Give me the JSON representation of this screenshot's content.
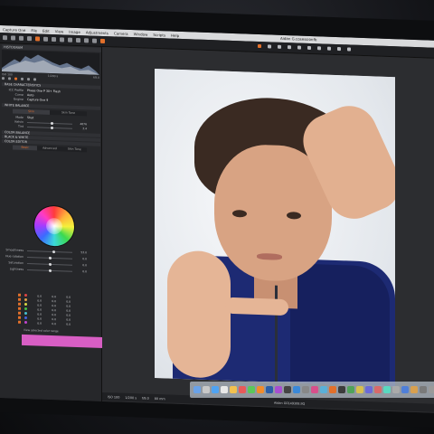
{
  "menubar": {
    "items": [
      "Capture One",
      "File",
      "Edit",
      "View",
      "Image",
      "Adjustments",
      "Camera",
      "Window",
      "Scripts",
      "Help"
    ],
    "window_title": "Aidan G.cosessionfb"
  },
  "panel": {
    "histogram_label": "HISTOGRAM",
    "readouts": {
      "iso": "ISO 100",
      "shutter": "1/200 s",
      "aperture": "f/8.0"
    },
    "base_characteristics": {
      "title": "BASE CHARACTERISTICS",
      "rows": [
        {
          "label": "ICC Profile",
          "value": "Phase One P 30+ Flash"
        },
        {
          "label": "Curve",
          "value": "Auto"
        },
        {
          "label": "Engine",
          "value": "Capture One 9"
        }
      ]
    },
    "white_balance": {
      "title": "WHITE BALANCE",
      "tabs": [
        "Skin",
        "Skin Tone"
      ],
      "rows": [
        {
          "label": "Mode",
          "value": "Shot",
          "num": ""
        },
        {
          "label": "Kelvin",
          "value": "",
          "num": "4876"
        },
        {
          "label": "Tint",
          "value": "",
          "num": "3.4"
        }
      ]
    },
    "sections": [
      "COLOR BALANCE",
      "BLACK & WHITE",
      "COLOR EDITOR"
    ],
    "color_editor_tabs": [
      "Basic",
      "Advanced",
      "Skin Tone"
    ],
    "sliders": [
      {
        "label": "Smoothness",
        "num": "53.0"
      },
      {
        "label": "Hue rotation",
        "num": "0.0"
      },
      {
        "label": "Saturation",
        "num": "0.0"
      },
      {
        "label": "Lightness",
        "num": "0.0"
      }
    ],
    "color_table": [
      {
        "c1": "0.0",
        "c2": "0.0",
        "c3": "0.0"
      },
      {
        "c1": "0.0",
        "c2": "0.0",
        "c3": "0.0"
      },
      {
        "c1": "0.0",
        "c2": "0.0",
        "c3": "0.0"
      },
      {
        "c1": "0.0",
        "c2": "0.0",
        "c3": "0.0"
      },
      {
        "c1": "0.0",
        "c2": "0.0",
        "c3": "0.0"
      },
      {
        "c1": "0.0",
        "c2": "0.0",
        "c3": "0.0"
      },
      {
        "c1": "0.0",
        "c2": "0.0",
        "c3": "0.0"
      }
    ],
    "swatch_label": "View selected color range",
    "swatch_color": "#d85ec4"
  },
  "viewer": {
    "status": {
      "iso": "ISO 100",
      "shutter": "1/200 s",
      "aperture": "f/8.0",
      "focal": "80 mm"
    },
    "filename": "Aidan G0149308.IIQ"
  },
  "dock": {
    "app_count": 30
  },
  "colors": {
    "accent": "#e2702b",
    "panel_bg": "#26272a",
    "shirt": "#1d2a73"
  }
}
